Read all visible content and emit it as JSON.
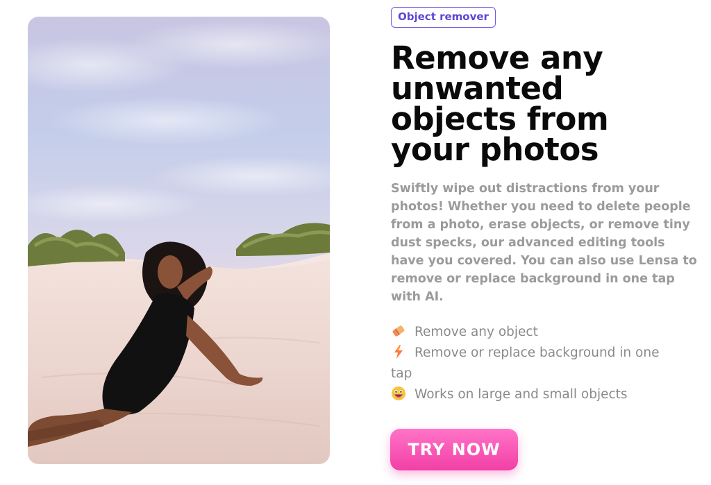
{
  "badge": {
    "label": "Object remover"
  },
  "headline": {
    "lines": [
      "Remove any",
      "unwanted",
      "objects from",
      "your photos"
    ]
  },
  "description": {
    "lines": [
      "Swiftly wipe out distractions from your",
      "photos! Whether you need to delete people",
      "from a photo, erase objects, or remove tiny",
      "dust specks, our advanced editing tools",
      "have you covered. You can also use Lensa to",
      "remove or replace background in one tap",
      "with AI."
    ]
  },
  "features": [
    {
      "icon": "eraser-icon",
      "lines": [
        "Remove any object"
      ]
    },
    {
      "icon": "lightning-icon",
      "lines": [
        "Remove or replace background in one",
        "tap"
      ]
    },
    {
      "icon": "grinning-face-icon",
      "lines": [
        "Works on large and small objects"
      ]
    }
  ],
  "cta": {
    "label": "TRY NOW"
  },
  "colors": {
    "badge_border": "#6f5ce6",
    "badge_text": "#5b47d6",
    "cta_gradient_top": "#ff74c7",
    "cta_gradient_bottom": "#f23fa6",
    "body_text": "#9b9b9b"
  }
}
